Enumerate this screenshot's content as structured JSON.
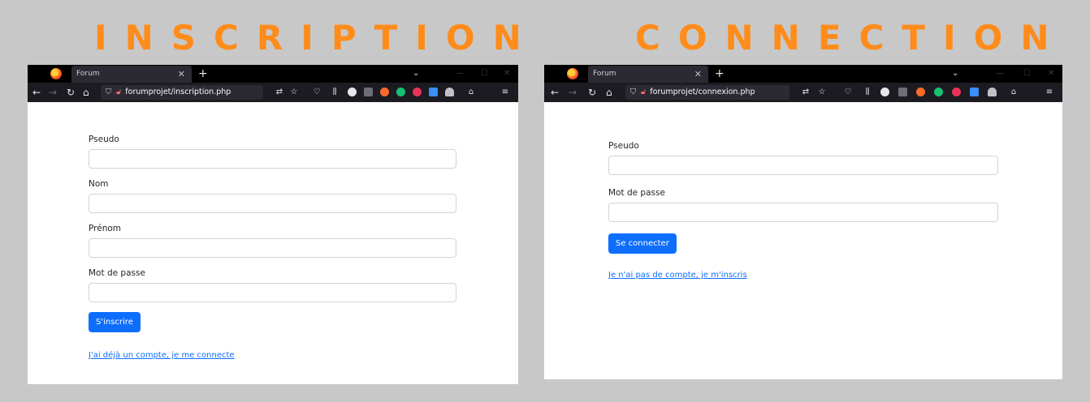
{
  "banners": {
    "left": "INSCRIPTION",
    "right": "CONNECTION"
  },
  "colors": {
    "banner": "#ff8c1a",
    "primary": "#0d6efd",
    "background": "#c8c8c8"
  },
  "register": {
    "tab_title": "Forum",
    "url": "forumprojet/inscription.php",
    "fields": [
      {
        "label": "Pseudo",
        "value": ""
      },
      {
        "label": "Nom",
        "value": ""
      },
      {
        "label": "Prénom",
        "value": ""
      },
      {
        "label": "Mot de passe",
        "value": ""
      }
    ],
    "submit_label": "S'inscrire",
    "switch_link": "J'ai déjà un compte, je me connecte"
  },
  "login": {
    "tab_title": "Forum",
    "url": "forumprojet/connexion.php",
    "fields": [
      {
        "label": "Pseudo",
        "value": ""
      },
      {
        "label": "Mot de passe",
        "value": ""
      }
    ],
    "submit_label": "Se connecter",
    "switch_link": "Je n'ai pas de compte, je m'inscris"
  },
  "icons": {
    "tab_close": "✕",
    "new_tab": "+",
    "tab_list": "⌄",
    "minimize": "—",
    "maximize": "☐",
    "close_window": "✕",
    "back": "←",
    "forward": "→",
    "reload": "↻",
    "home": "⌂",
    "shield": "⛉",
    "lock": "🔓︎",
    "translate": "⇄",
    "star": "☆",
    "pocket": "♡",
    "library": "⫼",
    "menu": "≡"
  }
}
